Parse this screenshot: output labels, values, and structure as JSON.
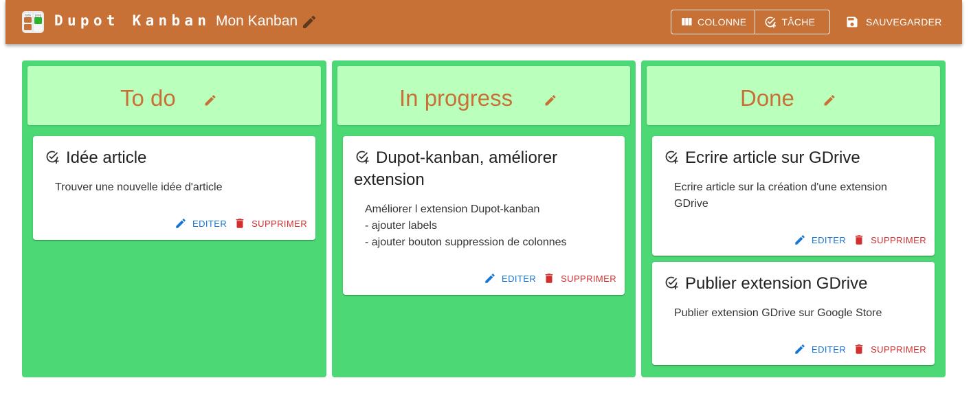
{
  "app": {
    "brand": "Dupot Kanban",
    "board_title": "Mon Kanban",
    "logo_labels": [
      "todo",
      "prog",
      "done"
    ]
  },
  "toolbar": {
    "colonne_label": "COLONNE",
    "tache_label": "TÂCHE",
    "save_label": "SAUVEGARDER"
  },
  "colors": {
    "appbar": "#c87137",
    "column_bg": "#4cd874",
    "column_header_bg": "#bbffbd",
    "column_title": "#c87137",
    "edit_action": "#1976d2",
    "delete_action": "#d32f2f"
  },
  "columns": [
    {
      "title": "To do",
      "cards": [
        {
          "title": "Idée article",
          "body": "Trouver une nouvelle idée d'article",
          "edit_label": "EDITER",
          "delete_label": "SUPPRIMER"
        }
      ]
    },
    {
      "title": "In progress",
      "cards": [
        {
          "title": "Dupot-kanban, améliorer extension",
          "body": "Améliorer l extension Dupot-kanban\n- ajouter labels\n- ajouter bouton suppression de colonnes",
          "edit_label": "EDITER",
          "delete_label": "SUPPRIMER"
        }
      ]
    },
    {
      "title": "Done",
      "cards": [
        {
          "title": "Ecrire article sur GDrive",
          "body": "Ecrire article sur la création d'une extension GDrive",
          "edit_label": "EDITER",
          "delete_label": "SUPPRIMER"
        },
        {
          "title": "Publier extension GDrive",
          "body": "Publier extension GDrive sur Google Store",
          "edit_label": "EDITER",
          "delete_label": "SUPPRIMER"
        }
      ]
    }
  ]
}
